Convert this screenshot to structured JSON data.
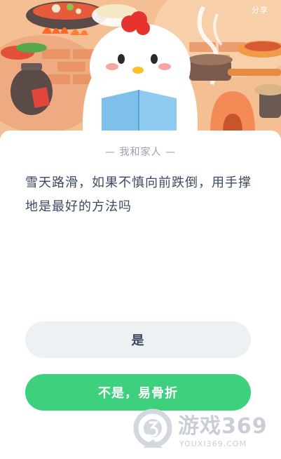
{
  "header": {
    "share_label": "分享"
  },
  "quiz": {
    "category": "— 我和家人 —",
    "question": "雪天路滑，如果不慎向前跌倒，用手撑地是最好的方法吗",
    "options": [
      {
        "label": "是"
      },
      {
        "label": "不是，易骨折"
      }
    ]
  },
  "watermark": {
    "title": "游戏369",
    "url": "YOUXI369.COM"
  },
  "colors": {
    "accent_green": "#3dd07d",
    "option_bg": "#eef1f4",
    "text_dark": "#3b4b63",
    "header_bg": "#f3b98c"
  }
}
